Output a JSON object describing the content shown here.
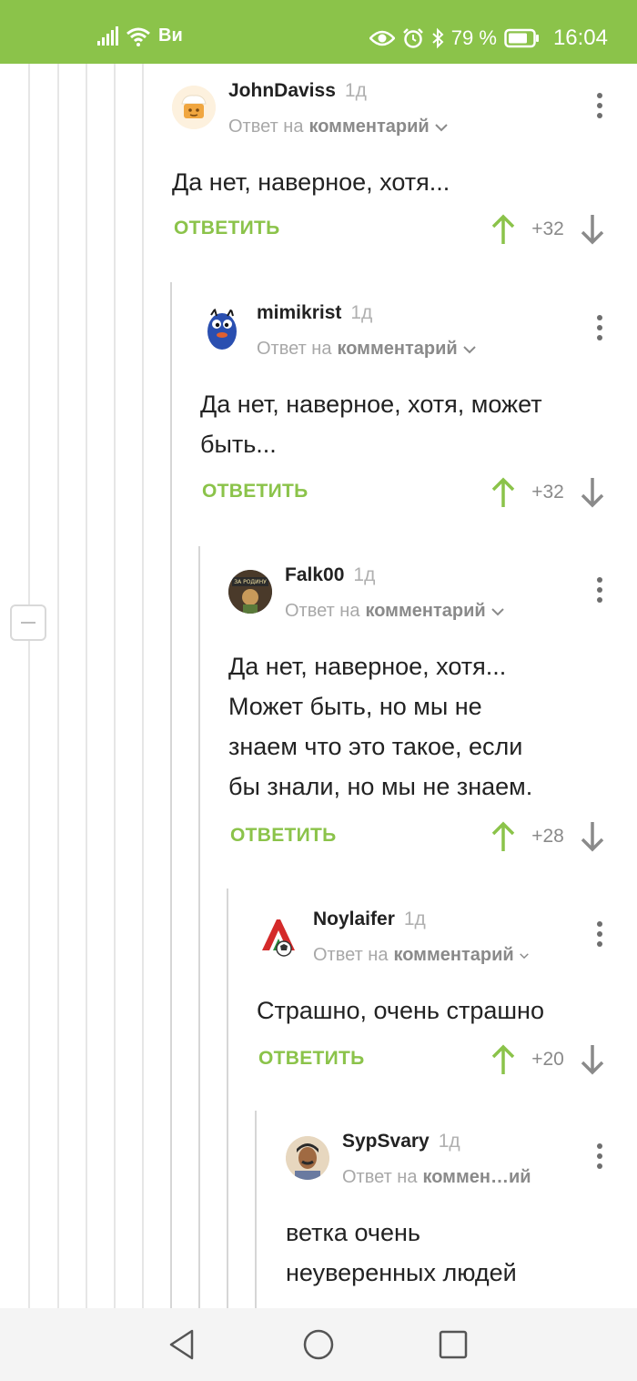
{
  "status_bar": {
    "carrier": "Ви",
    "battery": "79 %",
    "time": "16:04",
    "bg_color": "#8bc34a"
  },
  "accent_color": "#8bc34a",
  "reply_prefix": "Ответ на",
  "comments": [
    {
      "author": "JohnDaviss",
      "time": "1д",
      "reply_to": "комментарий",
      "text_lines": [
        "Да нет, наверное, хотя..."
      ],
      "reply_label": "ОТВЕТИТЬ",
      "score": "+32"
    },
    {
      "author": "mimikrist",
      "time": "1д",
      "reply_to": "комментарий",
      "text_lines": [
        "Да нет, наверное, хотя, может",
        "быть..."
      ],
      "reply_label": "ОТВЕТИТЬ",
      "score": "+32"
    },
    {
      "author": "Falk00",
      "time": "1д",
      "reply_to": "комментарий",
      "text_lines": [
        "Да нет, наверное, хотя...",
        "Может быть, но мы не",
        "знаем что это такое, если",
        "бы знали, но мы не знаем."
      ],
      "reply_label": "ОТВЕТИТЬ",
      "score": "+28"
    },
    {
      "author": "Noylaifer",
      "time": "1д",
      "reply_to": "комментарий",
      "text_lines": [
        "Страшно, очень страшно"
      ],
      "reply_label": "ОТВЕТИТЬ",
      "score": "+20"
    },
    {
      "author": "SypSvary",
      "time": "1д",
      "reply_to": "коммен…ий",
      "text_lines": [
        "ветка очень",
        "неуверенных людей"
      ]
    }
  ]
}
